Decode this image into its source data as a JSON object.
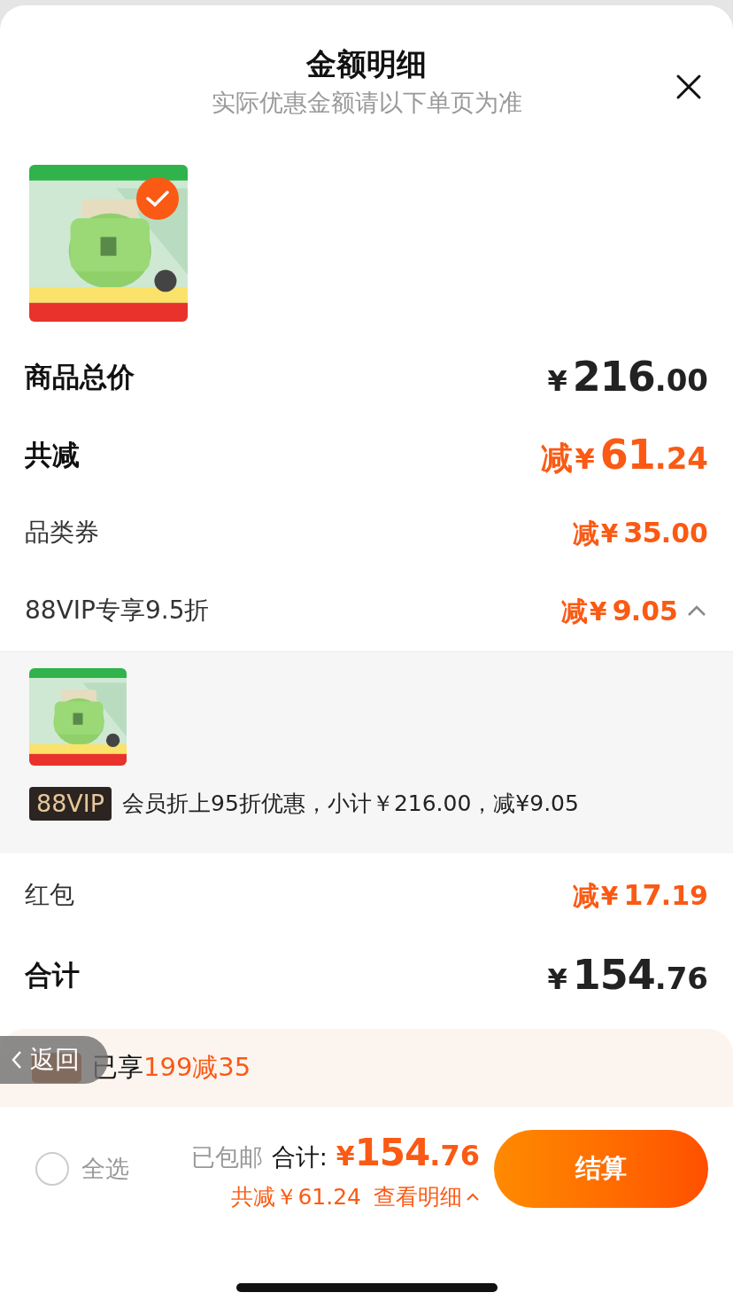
{
  "header": {
    "title": "金额明细",
    "subtitle": "实际优惠金额请以下单页为准"
  },
  "product": {
    "kind": "picture",
    "selected": true
  },
  "rows": [
    {
      "label": "商品总价",
      "kind": "total",
      "currency": "¥",
      "integer": "216",
      "decimal": ".00"
    },
    {
      "label": "共减",
      "kind": "discount_total",
      "prefix": "减",
      "currency": "¥",
      "integer": "61",
      "decimal": ".24"
    },
    {
      "label": "品类券",
      "kind": "discount",
      "prefix": "减",
      "currency": "¥",
      "integer": "35",
      "decimal": ".00"
    },
    {
      "label": "88VIP专享9.5折",
      "kind": "discount",
      "prefix": "减",
      "currency": "¥",
      "integer": "9",
      "decimal": ".05",
      "expanded": true
    }
  ],
  "detail": {
    "product": {
      "kind": "picture"
    },
    "badge": "88VIP",
    "text": "会员折上95折优惠，小计￥216.00，减¥9.05"
  },
  "rows_after": [
    {
      "label": "红包",
      "kind": "discount",
      "prefix": "减",
      "currency": "¥",
      "integer": "17",
      "decimal": ".19"
    },
    {
      "label": "合计",
      "kind": "total",
      "currency": "¥",
      "integer": "154",
      "decimal": ".76"
    }
  ],
  "promo": {
    "prefix": "已享",
    "highlight": "199减35"
  },
  "back_button": {
    "label": "返回"
  },
  "bottom_bar": {
    "select_all": {
      "label": "全选",
      "checked": false
    },
    "shipping": "已包邮",
    "total_label": "合计:",
    "currency": "¥",
    "integer": "154",
    "decimal": ".76",
    "saved": "共减￥61.24",
    "details_link": "查看明细",
    "checkout": "结算"
  }
}
